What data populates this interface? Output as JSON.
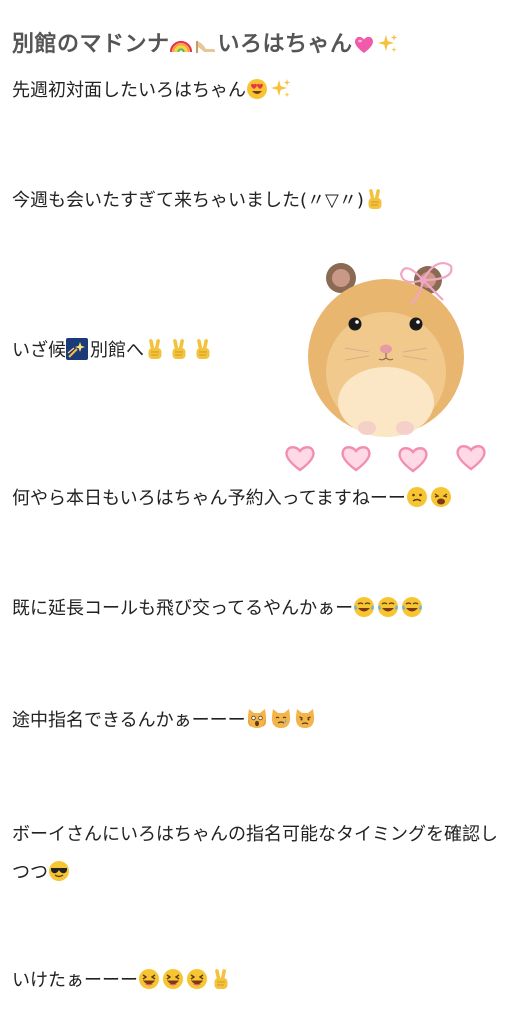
{
  "title": {
    "part1": "別館のマドンナ",
    "part2": "いろはちゃん",
    "emojis": [
      "rainbow-icon",
      "high-heel-icon",
      "pink-heart-icon",
      "sparkles-icon"
    ]
  },
  "lines": [
    {
      "text": "先週初対面したいろはちゃん",
      "emojis": [
        "heart-eyes-face-icon",
        "sparkles-icon"
      ]
    },
    {
      "text": "今週も会いたすぎて来ちゃいました(〃▽〃)",
      "emojis": [
        "victory-hand-icon"
      ]
    },
    {
      "text_before": "いざ候",
      "text_after": "別館へ",
      "emojis": [
        "shooting-star-icon",
        "victory-hand-icon",
        "victory-hand-icon",
        "victory-hand-icon"
      ]
    },
    {
      "text": "何やら本日もいろはちゃん予約入ってますねーー",
      "emojis": [
        "confused-face-icon",
        "weary-face-icon"
      ]
    },
    {
      "text": "既に延長コールも飛び交ってるやんかぁー",
      "emojis": [
        "tears-of-joy-icon",
        "tears-of-joy-icon",
        "tears-of-joy-icon"
      ]
    },
    {
      "text": "途中指名できるんかぁーーー",
      "emojis": [
        "scream-cat-icon",
        "crying-cat-icon",
        "pouting-cat-icon"
      ]
    },
    {
      "text": "ボーイさんにいろはちゃんの指名可能なタイミングを確認しつつ",
      "emojis": [
        "sunglasses-face-icon"
      ]
    },
    {
      "text": "いけたぁーーー",
      "emojis": [
        "laughing-face-icon",
        "laughing-face-icon",
        "laughing-face-icon",
        "victory-hand-icon"
      ]
    }
  ],
  "colors": {
    "title": "#555555",
    "text": "#222222",
    "hamster_fur": "#e9b66f",
    "ribbon": "#f2a6c4",
    "hearts": "#f28fb1"
  }
}
